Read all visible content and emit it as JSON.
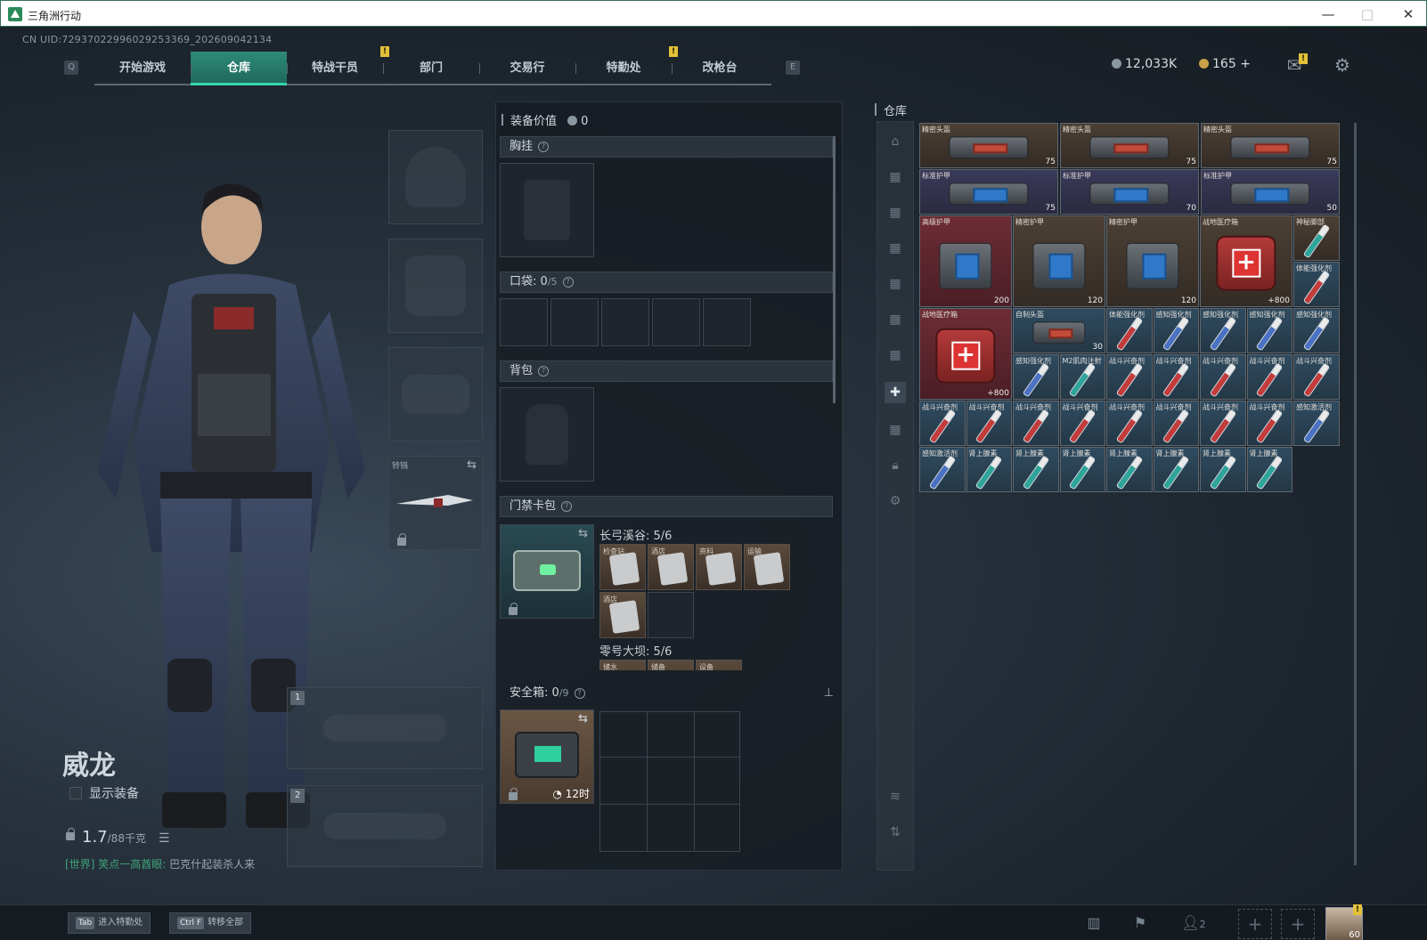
{
  "window": {
    "title": "三角洲行动",
    "controls": [
      "—",
      "□",
      "✕"
    ]
  },
  "uid": "CN UID:7293702299602925336​9_202609042134",
  "nav": {
    "left_key": "Q",
    "right_key": "E",
    "tabs": [
      {
        "label": "开始游戏",
        "active": false
      },
      {
        "label": "仓库",
        "active": true
      },
      {
        "label": "特战干员",
        "active": false,
        "badge": "!"
      },
      {
        "label": "部门",
        "active": false
      },
      {
        "label": "交易行",
        "active": false
      },
      {
        "label": "特勤处",
        "active": false,
        "badge": "!"
      },
      {
        "label": "改枪台",
        "active": false
      }
    ]
  },
  "currency": {
    "silver": "12,033K",
    "gold": "165",
    "plus": "+",
    "mail_badge": "!"
  },
  "character": {
    "name": "威龙",
    "show_equipment": "显示装备",
    "weight": "1.7",
    "weight_max": "/88千克"
  },
  "chat": {
    "channel": "[世界]",
    "name": "笑点一高酋眼:",
    "message": "巴克什起装杀人来"
  },
  "melee": {
    "label": "铃铛"
  },
  "weapon_slots": [
    "1",
    "2"
  ],
  "middle": {
    "equip_value_label": "装备价值",
    "equip_value": "0",
    "chest_rig": "胸挂",
    "pocket": "口袋:",
    "pocket_count": "0",
    "pocket_max": "/5",
    "backpack": "背包",
    "keycard": "门禁卡包",
    "keycard_groups": [
      {
        "name": "长弓溪谷: 5/6",
        "cards": [
          "检查站",
          "酒店",
          "资料",
          "运输",
          "酒店"
        ]
      },
      {
        "name": "零号大坝: 5/6",
        "cards": [
          "储水",
          "储备",
          "设备"
        ]
      }
    ],
    "safe": "安全箱:",
    "safe_count": "0",
    "safe_max": "/9",
    "safe_timer": "12时"
  },
  "warehouse": {
    "title": "仓库",
    "items": [
      {
        "name": "精密头盔",
        "val": "75",
        "kind": "bag hel",
        "bg": "b"
      },
      {
        "name": "精密头盔",
        "val": "75",
        "kind": "bag hel",
        "bg": "b"
      },
      {
        "name": "精密头盔",
        "val": "75",
        "kind": "bag hel",
        "bg": "b"
      },
      {
        "name": "标准护甲",
        "val": "75",
        "kind": "bag",
        "bg": "p"
      },
      {
        "name": "标准护甲",
        "val": "70",
        "kind": "bag",
        "bg": "p"
      },
      {
        "name": "标准护甲",
        "val": "50",
        "kind": "bag",
        "bg": "p"
      },
      {
        "name": "高级护甲",
        "val": "200",
        "kind": "bag",
        "bg": "r"
      },
      {
        "name": "精密护甲",
        "val": "120",
        "kind": "bag",
        "bg": "b"
      },
      {
        "name": "精密护甲",
        "val": "120",
        "kind": "bag",
        "bg": "b"
      },
      {
        "name": "战地医疗箱",
        "val": "+800",
        "kind": "med",
        "bg": "b"
      },
      {
        "name": "神秘脚部",
        "val": "",
        "kind": "syr teal",
        "bg": "b"
      },
      {
        "name": "体能强化剂",
        "val": "",
        "kind": "syr red",
        "bg": "n"
      },
      {
        "name": "战地医疗箱",
        "val": "+800",
        "kind": "med",
        "bg": "r"
      },
      {
        "name": "自制头盔",
        "val": "30",
        "kind": "bag hel",
        "bg": "n"
      },
      {
        "name": "体能强化剂",
        "val": "",
        "kind": "syr red",
        "bg": "n"
      },
      {
        "name": "感知强化剂",
        "val": "",
        "kind": "syr blue",
        "bg": "n"
      },
      {
        "name": "感知强化剂",
        "val": "",
        "kind": "syr blue",
        "bg": "n"
      },
      {
        "name": "感知强化剂",
        "val": "",
        "kind": "syr blue",
        "bg": "n"
      },
      {
        "name": "感知强化剂",
        "val": "",
        "kind": "syr blue",
        "bg": "n"
      },
      {
        "name": "感知强化剂",
        "val": "",
        "kind": "syr blue",
        "bg": "n"
      },
      {
        "name": "M2肌肉注射",
        "val": "",
        "kind": "syr teal",
        "bg": "n"
      },
      {
        "name": "战斗兴奋剂",
        "val": "",
        "kind": "syr red",
        "bg": "n"
      },
      {
        "name": "战斗兴奋剂",
        "val": "",
        "kind": "syr red",
        "bg": "n"
      },
      {
        "name": "战斗兴奋剂",
        "val": "",
        "kind": "syr red",
        "bg": "n"
      },
      {
        "name": "战斗兴奋剂",
        "val": "",
        "kind": "syr red",
        "bg": "n"
      },
      {
        "name": "战斗兴奋剂",
        "val": "",
        "kind": "syr red",
        "bg": "n"
      },
      {
        "name": "战斗兴奋剂",
        "val": "",
        "kind": "syr red",
        "bg": "n"
      },
      {
        "name": "战斗兴奋剂",
        "val": "",
        "kind": "syr red",
        "bg": "n"
      },
      {
        "name": "战斗兴奋剂",
        "val": "",
        "kind": "syr red",
        "bg": "n"
      },
      {
        "name": "战斗兴奋剂",
        "val": "",
        "kind": "syr red",
        "bg": "n"
      },
      {
        "name": "战斗兴奋剂",
        "val": "",
        "kind": "syr red",
        "bg": "n"
      },
      {
        "name": "战斗兴奋剂",
        "val": "",
        "kind": "syr red",
        "bg": "n"
      },
      {
        "name": "战斗兴奋剂",
        "val": "",
        "kind": "syr red",
        "bg": "n"
      },
      {
        "name": "战斗兴奋剂",
        "val": "",
        "kind": "syr red",
        "bg": "n"
      },
      {
        "name": "感知激活剂",
        "val": "",
        "kind": "syr blue",
        "bg": "n"
      },
      {
        "name": "感知激活剂",
        "val": "",
        "kind": "syr blue",
        "bg": "n"
      },
      {
        "name": "肾上腺素",
        "val": "",
        "kind": "syr teal",
        "bg": "n"
      },
      {
        "name": "肾上腺素",
        "val": "",
        "kind": "syr teal",
        "bg": "n"
      },
      {
        "name": "肾上腺素",
        "val": "",
        "kind": "syr teal",
        "bg": "n"
      },
      {
        "name": "肾上腺素",
        "val": "",
        "kind": "syr teal",
        "bg": "n"
      },
      {
        "name": "肾上腺素",
        "val": "",
        "kind": "syr teal",
        "bg": "n"
      },
      {
        "name": "肾上腺素",
        "val": "",
        "kind": "syr teal",
        "bg": "n"
      },
      {
        "name": "肾上腺素",
        "val": "",
        "kind": "syr teal",
        "bg": "n"
      }
    ]
  },
  "bottom": {
    "tab_hint": {
      "key": "Tab",
      "label": "进入特勤处"
    },
    "transfer_hint": {
      "key": "Ctrl F",
      "label": "转移全部"
    },
    "friends_count": "2",
    "level": "60",
    "avatar_badge": "!"
  }
}
